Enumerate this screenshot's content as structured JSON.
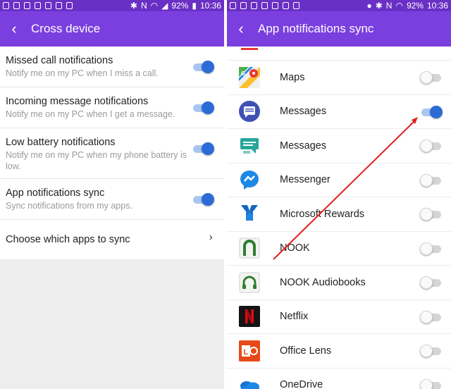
{
  "status_bar": {
    "battery": "92%",
    "time": "10:36"
  },
  "left": {
    "title": "Cross device",
    "settings": [
      {
        "title": "Missed call notifications",
        "subtitle": "Notify me on my PC when I miss a call.",
        "on": true
      },
      {
        "title": "Incoming message notifications",
        "subtitle": "Notify me on my PC when I get a message.",
        "on": true
      },
      {
        "title": "Low battery notifications",
        "subtitle": "Notify me on my PC when my phone battery is low.",
        "on": true
      },
      {
        "title": "App notifications sync",
        "subtitle": "Sync notifications from my apps.",
        "on": true
      }
    ],
    "choose_apps_label": "Choose which apps to sync"
  },
  "right": {
    "title": "App notifications sync",
    "apps": [
      {
        "label": "Maps",
        "icon": "google-maps-icon",
        "on": false
      },
      {
        "label": "Messages",
        "icon": "messages-icon",
        "on": true
      },
      {
        "label": "Messages",
        "icon": "chat-messages-icon",
        "on": false
      },
      {
        "label": "Messenger",
        "icon": "messenger-icon",
        "on": false
      },
      {
        "label": "Microsoft Rewards",
        "icon": "rewards-medal-icon",
        "on": false
      },
      {
        "label": "NOOK",
        "icon": "nook-icon",
        "on": false
      },
      {
        "label": "NOOK Audiobooks",
        "icon": "nook-audiobooks-icon",
        "on": false
      },
      {
        "label": "Netflix",
        "icon": "netflix-icon",
        "on": false
      },
      {
        "label": "Office Lens",
        "icon": "office-lens-icon",
        "on": false
      },
      {
        "label": "OneDrive",
        "icon": "onedrive-icon",
        "on": false
      }
    ]
  },
  "colors": {
    "statusbar": "#6a2fc4",
    "appbar": "#7b3fdf",
    "toggle_on": "#2c6bd6",
    "arrow": "#e02020"
  }
}
